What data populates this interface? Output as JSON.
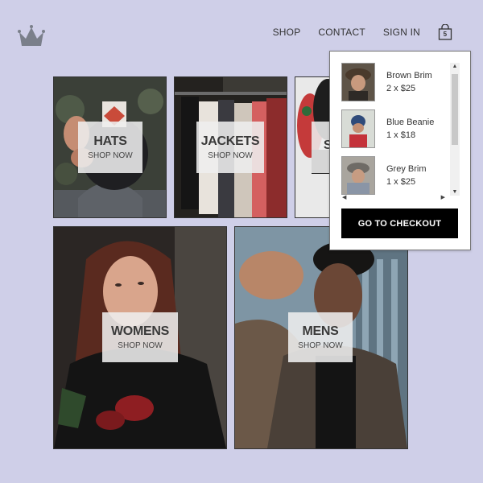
{
  "nav": {
    "links": [
      "SHOP",
      "CONTACT",
      "SIGN IN"
    ],
    "cart_count": "5"
  },
  "tiles": [
    {
      "title": "HATS",
      "subtitle": "SHOP NOW"
    },
    {
      "title": "JACKETS",
      "subtitle": "SHOP NOW"
    },
    {
      "title": "S",
      "subtitle": ""
    },
    {
      "title": "WOMENS",
      "subtitle": "SHOP NOW"
    },
    {
      "title": "MENS",
      "subtitle": "SHOP NOW"
    }
  ],
  "cart": {
    "items": [
      {
        "name": "Brown Brim",
        "qty": "2 x $25"
      },
      {
        "name": "Blue Beanie",
        "qty": "1 x $18"
      },
      {
        "name": "Grey Brim",
        "qty": "1 x $25"
      }
    ],
    "checkout_label": "GO TO CHECKOUT"
  },
  "colors": {
    "background": "#cfcfe8",
    "checkout_button": "#000000",
    "label_box": "#eeeeee"
  }
}
